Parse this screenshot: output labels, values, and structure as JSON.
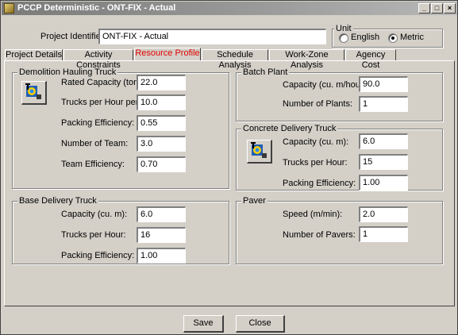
{
  "window": {
    "title": "PCCP Deterministic - ONT-FIX - Actual",
    "minimize_glyph": "_",
    "maximize_glyph": "□",
    "close_glyph": "×"
  },
  "header": {
    "project_identifier_label": "Project Identifier:",
    "project_identifier_value": "ONT-FIX - Actual",
    "unit_label": "Unit",
    "unit_options": [
      "English",
      "Metric"
    ],
    "unit_selected": "Metric"
  },
  "tabs": [
    {
      "label": "Project Details"
    },
    {
      "label": "Activity Constraints"
    },
    {
      "label": "Resource Profile",
      "active": true
    },
    {
      "label": "Schedule Analysis"
    },
    {
      "label": "Work-Zone Analysis"
    },
    {
      "label": "Agency Cost"
    }
  ],
  "demolition_hauling_truck": {
    "title": "Demolition Hauling Truck",
    "icon": "truck-icon",
    "fields": [
      {
        "label": "Rated Capacity (tonne):",
        "value": "22.0"
      },
      {
        "label": "Trucks per Hour per Team:",
        "value": "10.0"
      },
      {
        "label": "Packing Efficiency:",
        "value": "0.55"
      },
      {
        "label": "Number of Team:",
        "value": "3.0"
      },
      {
        "label": "Team Efficiency:",
        "value": "0.70"
      }
    ]
  },
  "base_delivery_truck": {
    "title": "Base Delivery Truck",
    "fields": [
      {
        "label": "Capacity (cu. m):",
        "value": "6.0"
      },
      {
        "label": "Trucks per Hour:",
        "value": "16"
      },
      {
        "label": "Packing Efficiency:",
        "value": "1.00"
      }
    ]
  },
  "batch_plant": {
    "title": "Batch Plant",
    "fields": [
      {
        "label": "Capacity (cu. m/hour):",
        "value": "90.0"
      },
      {
        "label": "Number of Plants:",
        "value": "1"
      }
    ]
  },
  "concrete_delivery_truck": {
    "title": "Concrete Delivery Truck",
    "icon": "truck-icon",
    "fields": [
      {
        "label": "Capacity (cu. m):",
        "value": "6.0"
      },
      {
        "label": "Trucks per Hour:",
        "value": "15"
      },
      {
        "label": "Packing Efficiency:",
        "value": "1.00"
      }
    ]
  },
  "paver": {
    "title": "Paver",
    "fields": [
      {
        "label": "Speed (m/min):",
        "value": "2.0"
      },
      {
        "label": "Number of Pavers:",
        "value": "1"
      }
    ]
  },
  "buttons": {
    "save": "Save",
    "close": "Close"
  }
}
